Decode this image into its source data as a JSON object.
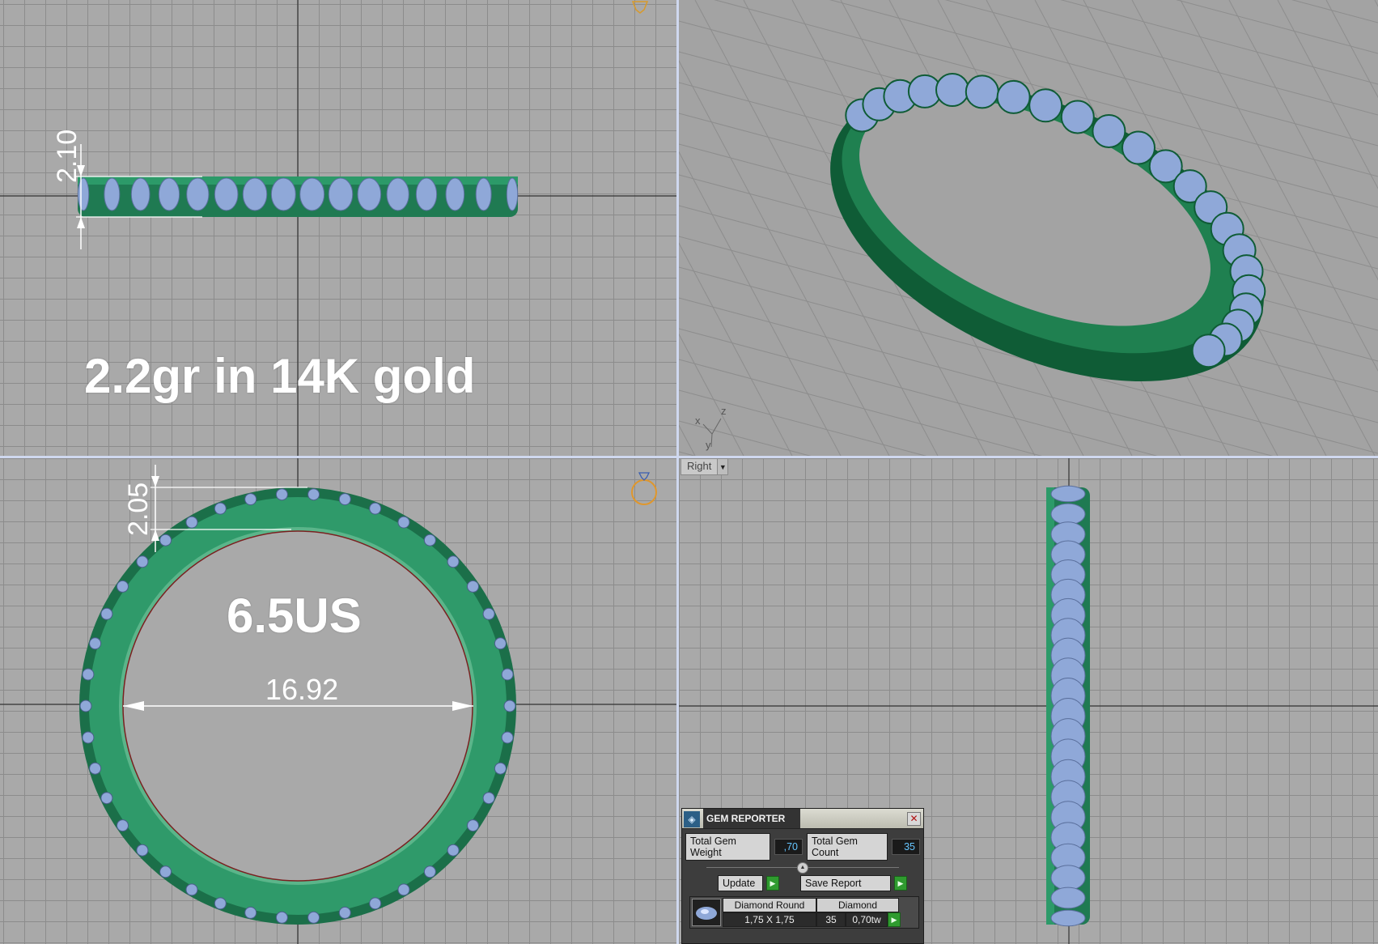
{
  "viewports": {
    "top_left": {
      "annotation": "2.2gr in 14K gold",
      "dimension_label": "2.10"
    },
    "top_right": {
      "axis_labels": [
        "x",
        "z",
        "y"
      ]
    },
    "bottom_left": {
      "annotation": "6.5US",
      "dimension_thickness": "2.05",
      "dimension_diameter": "16.92"
    },
    "bottom_right": {
      "view_name": "Right"
    }
  },
  "gem_reporter": {
    "title": "GEM REPORTER",
    "total_gem_weight_label": "Total Gem Weight",
    "total_gem_weight_value": ",70",
    "total_gem_count_label": "Total Gem Count",
    "total_gem_count_value": "35",
    "update_label": "Update",
    "save_report_label": "Save Report",
    "table": {
      "shape_header": "Diamond Round",
      "material_header": "Diamond",
      "size": "1,75 X 1,75",
      "count": "35",
      "weight": "0,70tw"
    }
  },
  "colors": {
    "metal": "#1f7a52",
    "gem": "#8fa8d8",
    "viewport_bg": "#a9a9a9",
    "dimension": "#ffffff"
  },
  "icons": [
    "diamond-icon",
    "ring-icon",
    "close-icon",
    "play-icon",
    "gem-thumbnail-icon",
    "dropdown-icon"
  ]
}
